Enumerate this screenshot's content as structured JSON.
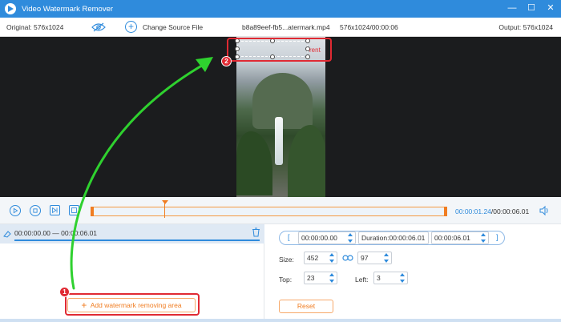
{
  "titlebar": {
    "title": "Video Watermark Remover",
    "logo_icon": "play-logo-icon",
    "controls": [
      "minimize-icon",
      "maximize-icon",
      "close-icon"
    ]
  },
  "infobar": {
    "original": "Original: 576x1024",
    "change_source": "Change Source File",
    "file_name": "b8a89eef-fb5...atermark.mp4",
    "file_meta": "576x1024/00:00:06",
    "output": "Output: 576x1024"
  },
  "preview": {
    "watermark_text": "rent",
    "step2_badge": "2"
  },
  "timeline": {
    "current": "00:00:01.24",
    "total": "/00:00:06.01",
    "progress": 0.206
  },
  "segment": {
    "range": "00:00:00.00 — 00:00:06.01"
  },
  "add_area": {
    "label": "Add watermark removing area",
    "step1_badge": "1"
  },
  "settings": {
    "start": "00:00:00.00",
    "duration": "Duration:00:00:06.01",
    "end": "00:00:06.01",
    "size_label": "Size:",
    "width": "452",
    "height": "97",
    "top_label": "Top:",
    "top": "23",
    "left_label": "Left:",
    "left": "3",
    "reset": "Reset"
  },
  "colors": {
    "accent": "#2f8bdc",
    "orange": "#f07d22",
    "red": "#e02a33",
    "arrow": "#2fd12f"
  }
}
